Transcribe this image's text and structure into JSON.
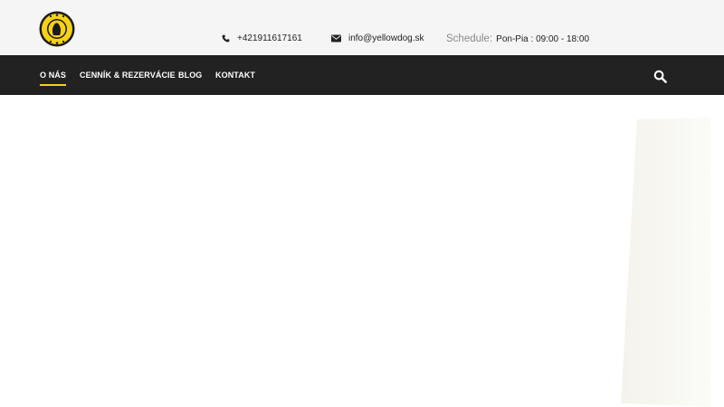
{
  "header": {
    "logo_icon": "yellow-dog-logo",
    "phone": "+421911617161",
    "phone_icon": "phone-icon",
    "email": "info@yellowdog.sk",
    "email_icon": "envelope-icon",
    "schedule_label": "Schedule:",
    "schedule_value": "Pon-Pia : 09:00 - 18:00"
  },
  "nav": {
    "items": [
      {
        "label": "O NÁS",
        "active": true
      },
      {
        "label": "CENNÍK & REZERVÁCIE",
        "active": false
      },
      {
        "label": "BLOG",
        "active": false
      },
      {
        "label": "KONTAKT",
        "active": false
      }
    ],
    "search_icon": "search-icon"
  },
  "colors": {
    "accent": "#f7d117",
    "topbar_bg": "#f5f5f5",
    "nav_bg": "#222222",
    "nav_text": "#ffffff"
  }
}
